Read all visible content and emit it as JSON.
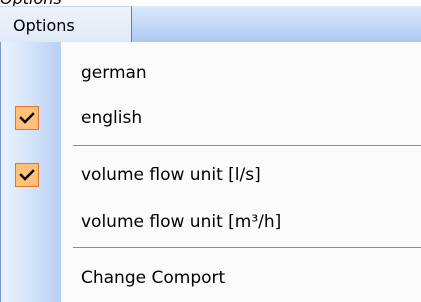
{
  "header_fragment": "Options",
  "menubar": {
    "menu_title": "Options"
  },
  "menu": {
    "items": [
      {
        "label": "german",
        "checked": false
      },
      {
        "label": "english",
        "checked": true
      },
      {
        "label": "volume flow unit [l/s]",
        "checked": true
      },
      {
        "label": "volume flow unit [m³/h]",
        "checked": false
      },
      {
        "label": "Change Comport",
        "checked": false
      }
    ]
  },
  "colors": {
    "check_fill": "#ffc079",
    "check_border": "#e3752a",
    "separator": "#6d8fd3",
    "gutter_right": "#b8d0f3"
  }
}
